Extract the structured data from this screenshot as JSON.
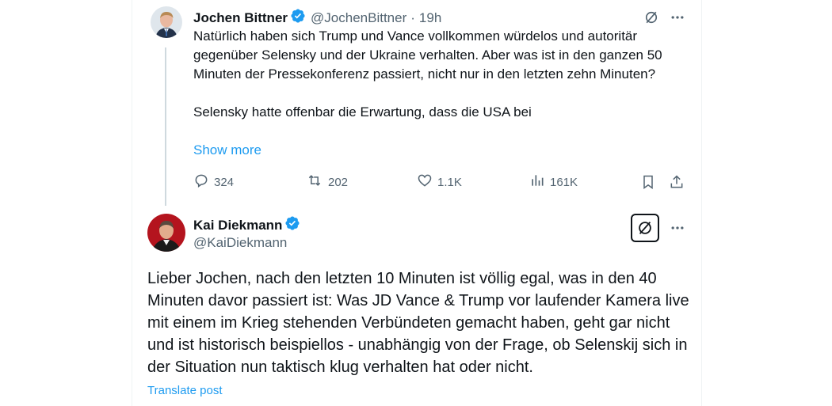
{
  "tweet1": {
    "author_name": "Jochen Bittner",
    "handle": "@JochenBittner",
    "separator": "·",
    "time": "19h",
    "paragraphs": [
      "Natürlich haben sich Trump und Vance vollkommen würdelos und autoritär gegenüber Selensky und der Ukraine verhalten. Aber was ist in den ganzen 50 Minuten der Pressekonferenz passiert, nicht nur in den letzten zehn Minuten?",
      "Selensky hatte offenbar die Erwartung, dass die USA bei"
    ],
    "show_more": "Show more",
    "stats": {
      "replies": "324",
      "reposts": "202",
      "likes": "1.1K",
      "views": "161K"
    }
  },
  "tweet2": {
    "author_name": "Kai Diekmann",
    "handle": "@KaiDiekmann",
    "body": "Lieber Jochen, nach den letzten 10 Minuten ist völlig egal, was in den 40 Minuten davor passiert ist: Was JD Vance & Trump vor laufender Kamera live mit einem im Krieg stehenden Verbündeten gemacht haben, geht gar nicht und ist historisch beispiellos - unabhängig von der Frage, ob Selenskij sich in der Situation nun taktisch klug verhalten hat oder nicht.",
    "translate": "Translate post"
  },
  "icons": {
    "verified": "verified-badge-icon",
    "grok": "grok-icon",
    "more": "more-icon",
    "reply": "reply-icon",
    "repost": "repost-icon",
    "like": "like-icon",
    "views": "views-icon",
    "bookmark": "bookmark-icon",
    "share": "share-icon"
  },
  "colors": {
    "accent": "#1d9bf0",
    "text": "#0f1419",
    "muted": "#536471",
    "border": "#eff3f4"
  }
}
